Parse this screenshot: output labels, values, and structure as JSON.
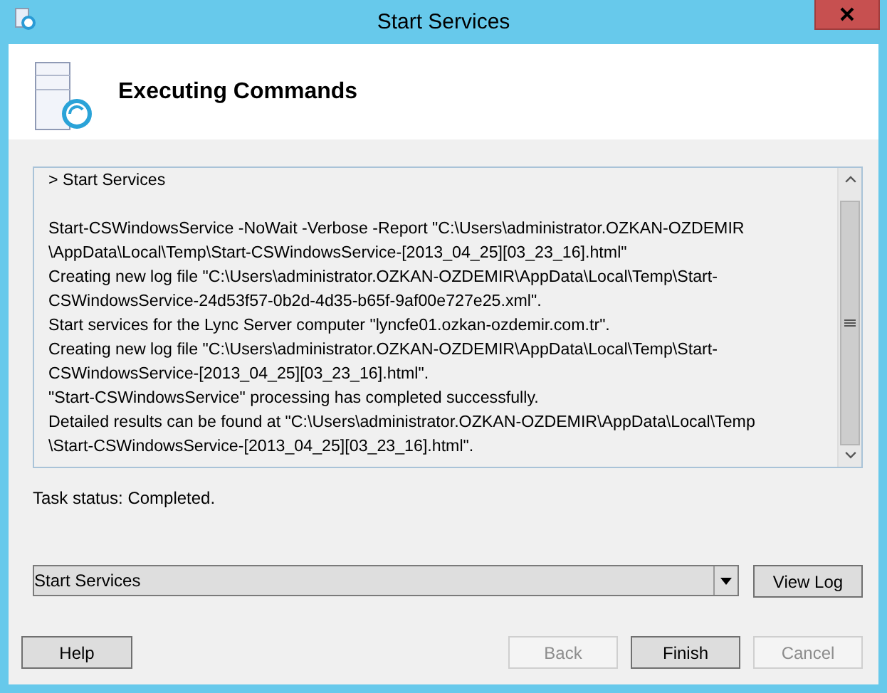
{
  "window": {
    "title": "Start Services"
  },
  "header": {
    "title": "Executing Commands"
  },
  "log": {
    "heading": "> Start Services",
    "lines": [
      "Start-CSWindowsService -NoWait -Verbose -Report \"C:\\Users\\administrator.OZKAN-OZDEMIR",
      "\\AppData\\Local\\Temp\\Start-CSWindowsService-[2013_04_25][03_23_16].html\"",
      "Creating new log file \"C:\\Users\\administrator.OZKAN-OZDEMIR\\AppData\\Local\\Temp\\Start-",
      "CSWindowsService-24d53f57-0b2d-4d35-b65f-9af00e727e25.xml\".",
      "Start services for the Lync Server computer \"lyncfe01.ozkan-ozdemir.com.tr\".",
      "Creating new log file \"C:\\Users\\administrator.OZKAN-OZDEMIR\\AppData\\Local\\Temp\\Start-",
      "CSWindowsService-[2013_04_25][03_23_16].html\".",
      "\"Start-CSWindowsService\" processing has completed successfully.",
      "Detailed results can be found at \"C:\\Users\\administrator.OZKAN-OZDEMIR\\AppData\\Local\\Temp",
      "\\Start-CSWindowsService-[2013_04_25][03_23_16].html\"."
    ]
  },
  "task_status": "Task status: Completed.",
  "task_dropdown": {
    "value": "Start Services"
  },
  "view_log_button": {
    "label": "View Log"
  },
  "buttons": [
    {
      "label": "Help",
      "disabled": false
    },
    {
      "label": "Back",
      "disabled": true
    },
    {
      "label": "Finish",
      "disabled": false
    },
    {
      "label": "Cancel",
      "disabled": true
    }
  ]
}
